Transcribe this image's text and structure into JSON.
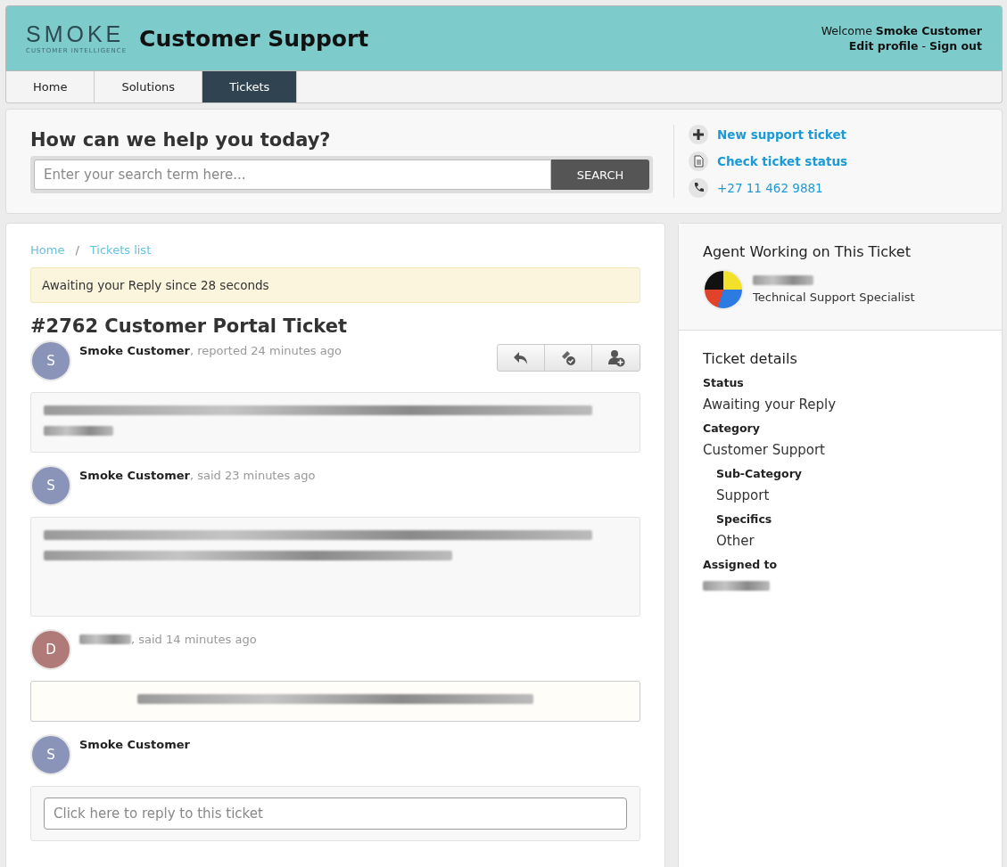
{
  "header": {
    "logo": {
      "word": "SMOKE",
      "tagline": "CUSTOMER INTELLIGENCE"
    },
    "title": "Customer Support",
    "welcome": "Welcome",
    "user": "Smoke Customer",
    "links": [
      "Edit profile",
      "Sign out"
    ],
    "link_separator": "-"
  },
  "tabs": [
    {
      "label": "Home",
      "selected": false
    },
    {
      "label": "Solutions",
      "selected": false
    },
    {
      "label": "Tickets",
      "selected": true
    }
  ],
  "help": {
    "heading": "How can we help you today?",
    "search": {
      "placeholder": "Enter your search term here...",
      "button": "SEARCH"
    },
    "links": [
      {
        "kind": "new",
        "label": "New support ticket"
      },
      {
        "kind": "status",
        "label": "Check ticket status"
      },
      {
        "kind": "phone",
        "label": "+27 11 462 9881"
      }
    ]
  },
  "breadcrumb": [
    "Home",
    "Tickets list"
  ],
  "breadcrumb_separator": "/",
  "notice": "Awaiting your Reply since 28 seconds",
  "ticket_title": "#2762 Customer Portal Ticket",
  "messages": [
    {
      "kind": "customer",
      "initial": "S",
      "color": "#8a93b8",
      "author": "Smoke Customer",
      "author_redacted": false,
      "action": ", reported 24 minutes ago",
      "actions": true,
      "body_lines": [
        {
          "kind": "long"
        },
        {
          "kind": "short"
        }
      ]
    },
    {
      "kind": "customer",
      "initial": "S",
      "color": "#8a93b8",
      "author": "Smoke Customer",
      "author_redacted": false,
      "action": ", said 23 minutes ago",
      "actions": false,
      "body_lines": [
        {
          "kind": "long"
        },
        {
          "kind": "medium"
        }
      ]
    },
    {
      "kind": "agent",
      "initial": "D",
      "color": "#b07a78",
      "author_redacted": true,
      "action": ", said 14 minutes ago",
      "actions": false,
      "body_lines": [
        {
          "kind": "wide"
        }
      ]
    }
  ],
  "reply": {
    "initial": "S",
    "color": "#8a93b8",
    "author": "Smoke Customer",
    "placeholder": "Click here to reply to this ticket"
  },
  "agent_panel": {
    "heading": "Agent Working on This Ticket",
    "name_redacted": true,
    "role": "Technical Support Specialist"
  },
  "details": {
    "heading": "Ticket details",
    "fields": [
      {
        "label": "Status",
        "value": "Awaiting your Reply",
        "sub": false
      },
      {
        "label": "Category",
        "value": "Customer Support",
        "sub": false
      },
      {
        "label": "Sub-Category",
        "value": "Support",
        "sub": true
      },
      {
        "label": "Specifics",
        "value": "Other",
        "sub": true
      },
      {
        "label": "Assigned to",
        "value_redacted": true,
        "sub": false
      }
    ]
  }
}
